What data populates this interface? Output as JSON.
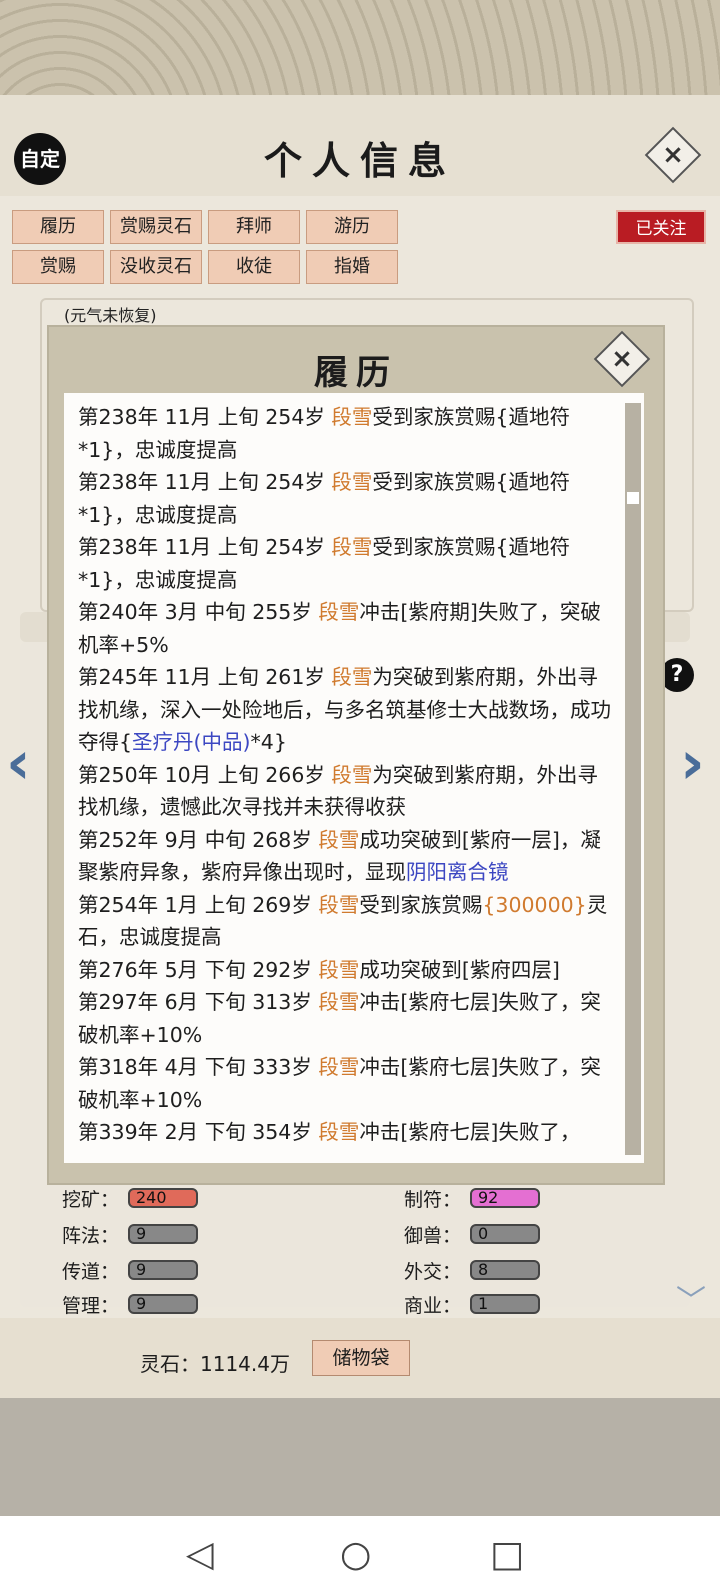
{
  "header": {
    "title": "个人信息",
    "auto_label": "自定",
    "close": "×"
  },
  "tabs": [
    "履历",
    "赏赐灵石",
    "拜师",
    "游历",
    "赏赐",
    "没收灵石",
    "收徒",
    "指婚"
  ],
  "follow_label": "已关注",
  "behind": {
    "status_note": "(元气未恢复)"
  },
  "modal": {
    "title": "履历",
    "close": "×",
    "entries": [
      [
        {
          "t": "第238年 11月 上旬  254岁  "
        },
        {
          "t": "段雪",
          "c": "name"
        },
        {
          "t": "受到家族赏赐{遁地符*1}，忠诚度提高"
        }
      ],
      [
        {
          "t": "第238年 11月 上旬  254岁  "
        },
        {
          "t": "段雪",
          "c": "name"
        },
        {
          "t": "受到家族赏赐{遁地符*1}，忠诚度提高"
        }
      ],
      [
        {
          "t": "第238年 11月 上旬  254岁  "
        },
        {
          "t": "段雪",
          "c": "name"
        },
        {
          "t": "受到家族赏赐{遁地符*1}，忠诚度提高"
        }
      ],
      [
        {
          "t": "第240年 3月 中旬 255岁 "
        },
        {
          "t": "段雪",
          "c": "name"
        },
        {
          "t": "冲击[紫府期]失败了，突破机率+5%"
        }
      ],
      [
        {
          "t": "第245年 11月 上旬 261岁 "
        },
        {
          "t": "段雪",
          "c": "name"
        },
        {
          "t": "为突破到紫府期，外出寻找机缘，深入一处险地后，与多名筑基修士大战数场，成功夺得{"
        },
        {
          "t": "圣疗丹(中品)",
          "c": "item"
        },
        {
          "t": "*4}"
        }
      ],
      [
        {
          "t": "第250年 10月 上旬 266岁 "
        },
        {
          "t": "段雪",
          "c": "name"
        },
        {
          "t": "为突破到紫府期，外出寻找机缘，遗憾此次寻找并未获得收获"
        }
      ],
      [
        {
          "t": "第252年 9月 中旬 268岁 "
        },
        {
          "t": "段雪",
          "c": "name"
        },
        {
          "t": "成功突破到[紫府一层]，凝聚紫府异象，紫府异像出现时，显现"
        },
        {
          "t": "阴阳离合镜",
          "c": "item"
        }
      ],
      [
        {
          "t": "第254年  1月  上旬   269岁   "
        },
        {
          "t": "段雪",
          "c": "name"
        },
        {
          "t": "受到家族赏赐"
        },
        {
          "t": "{300000}",
          "c": "name"
        },
        {
          "t": "灵石，忠诚度提高"
        }
      ],
      [
        {
          "t": "第276年 5月 下旬 292岁 "
        },
        {
          "t": "段雪",
          "c": "name"
        },
        {
          "t": "成功突破到[紫府四层]"
        }
      ],
      [
        {
          "t": "第297年 6月 下旬 313岁 "
        },
        {
          "t": "段雪",
          "c": "name"
        },
        {
          "t": "冲击[紫府七层]失败了，突破机率+10%"
        }
      ],
      [
        {
          "t": "第318年 4月 下旬 333岁 "
        },
        {
          "t": "段雪",
          "c": "name"
        },
        {
          "t": "冲击[紫府七层]失败了，突破机率+10%"
        }
      ],
      [
        {
          "t": "第339年 2月 下旬 354岁 "
        },
        {
          "t": "段雪",
          "c": "name"
        },
        {
          "t": "冲击[紫府七层]失败了，"
        }
      ]
    ]
  },
  "stats": {
    "left": [
      {
        "label": "挖矿：",
        "value": "240",
        "style": "red"
      },
      {
        "label": "阵法：",
        "value": "9",
        "style": "gray"
      },
      {
        "label": "传道：",
        "value": "9",
        "style": "gray"
      },
      {
        "label": "管理：",
        "value": "9",
        "style": "gray"
      }
    ],
    "right": [
      {
        "label": "制符：",
        "value": "92",
        "style": "pink"
      },
      {
        "label": "御兽：",
        "value": "0",
        "style": "gray"
      },
      {
        "label": "外交：",
        "value": "8",
        "style": "gray"
      },
      {
        "label": "商业：",
        "value": "1",
        "style": "gray"
      }
    ]
  },
  "bottom": {
    "stone_text": "灵石：1114.4万",
    "bag_label": "储物袋"
  },
  "colors": {
    "name": "#d07a2e",
    "item": "#3c47c2",
    "follow": "#b91c23"
  }
}
